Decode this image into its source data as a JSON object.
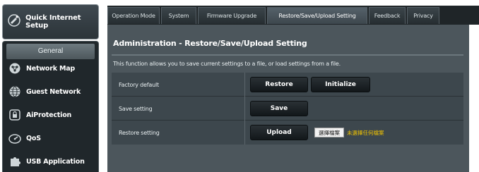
{
  "sidebar": {
    "quick_setup_label": "Quick Internet Setup",
    "general_label": "General",
    "items": [
      {
        "label": "Network Map",
        "icon": "network-map-icon"
      },
      {
        "label": "Guest Network",
        "icon": "globe-icon"
      },
      {
        "label": "AiProtection",
        "icon": "lock-icon"
      },
      {
        "label": "QoS",
        "icon": "speedometer-icon"
      },
      {
        "label": "USB Application",
        "icon": "puzzle-icon"
      }
    ]
  },
  "tabs": [
    {
      "label": "Operation Mode",
      "active": false
    },
    {
      "label": "System",
      "active": false
    },
    {
      "label": "Firmware Upgrade",
      "active": false
    },
    {
      "label": "Restore/Save/Upload Setting",
      "active": true
    },
    {
      "label": "Feedback",
      "active": false
    },
    {
      "label": "Privacy",
      "active": false
    }
  ],
  "main": {
    "title": "Administration - Restore/Save/Upload Setting",
    "description": "This function allows you to save current settings to a file, or load settings from a file.",
    "rows": {
      "factory_default": {
        "label": "Factory default",
        "restore_button": "Restore",
        "initialize_button": "Initialize"
      },
      "save_setting": {
        "label": "Save setting",
        "save_button": "Save"
      },
      "restore_setting": {
        "label": "Restore setting",
        "upload_button": "Upload",
        "choose_file_button": "選擇檔案",
        "file_status": "未選擇任何檔案"
      }
    }
  },
  "colors": {
    "panel_bg": "#4c565c",
    "table_bg": "#3d474d",
    "button_bg": "#12171a",
    "file_status_text": "#f2c400"
  }
}
